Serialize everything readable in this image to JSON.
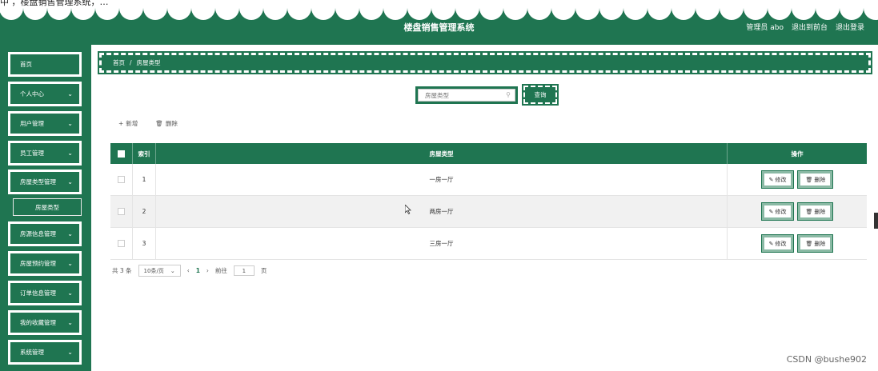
{
  "top_strip": {
    "text": "中 ，楼盘销售管理系统，…"
  },
  "header": {
    "title": "楼盘销售管理系统",
    "user_label": "管理员 abo",
    "goto_frontend": "退出到前台",
    "logout": "退出登录",
    "brand_color": "#1f7551"
  },
  "sidebar": {
    "items": [
      {
        "label": "首页",
        "has_chevron": false
      },
      {
        "label": "个人中心",
        "has_chevron": true
      },
      {
        "label": "用户管理",
        "has_chevron": true
      },
      {
        "label": "员工管理",
        "has_chevron": true
      },
      {
        "label": "房屋类型管理",
        "has_chevron": true,
        "expanded": true
      },
      {
        "label": "房源信息管理",
        "has_chevron": true
      },
      {
        "label": "房屋预约管理",
        "has_chevron": true
      },
      {
        "label": "订单信息管理",
        "has_chevron": true
      },
      {
        "label": "我的收藏管理",
        "has_chevron": true
      },
      {
        "label": "系统管理",
        "has_chevron": true
      }
    ],
    "submenu": {
      "label": "房屋类型"
    }
  },
  "breadcrumb": {
    "home": "首页",
    "separator": "/",
    "current": "房屋类型"
  },
  "search": {
    "placeholder": "房屋类型",
    "value": "",
    "button_label": "查询"
  },
  "toolbar": {
    "add_label": "新增",
    "delete_label": "删除"
  },
  "table": {
    "headers": {
      "index": "索引",
      "type": "房屋类型",
      "actions": "操作"
    },
    "rows": [
      {
        "index": "1",
        "type": "一房一厅"
      },
      {
        "index": "2",
        "type": "两房一厅"
      },
      {
        "index": "3",
        "type": "三房一厅"
      }
    ],
    "edit_label": "修改",
    "delete_label": "删除"
  },
  "pagination": {
    "total": "共 3 条",
    "page_size": "10条/页",
    "current_page": "1",
    "goto_label": "前往",
    "goto_value": "1",
    "page_suffix": "页"
  },
  "watermark": "CSDN @bushe902"
}
